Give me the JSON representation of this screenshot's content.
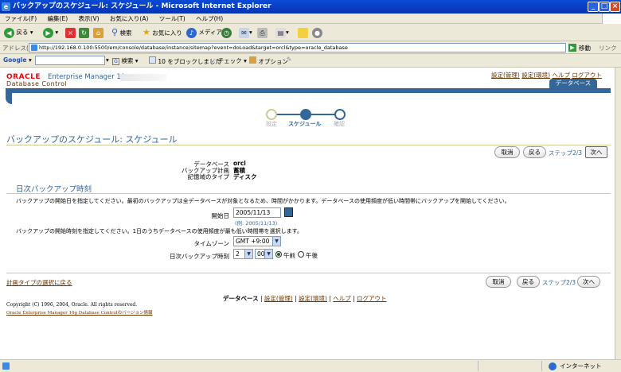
{
  "window": {
    "title": "バックアップのスケジュール: スケジュール - Microsoft Internet Explorer"
  },
  "menu": [
    "ファイル(F)",
    "編集(E)",
    "表示(V)",
    "お気に入り(A)",
    "ツール(T)",
    "ヘルプ(H)"
  ],
  "toolbar": {
    "back": "戻る",
    "search": "検索",
    "favorites": "お気に入り",
    "media": "メディア"
  },
  "address": {
    "label": "アドレス(D)",
    "url": "http://192.168.0.100:5500/em/console/database/instance/sitemap?event=doLoad&target=orcl&type=oracle_database",
    "go": "移動",
    "links": "リンク"
  },
  "google": {
    "logo": "Google",
    "search": "検索",
    "blocked": "10 をブロックしました",
    "check": "チェック",
    "options": "オプション"
  },
  "header": {
    "oracle": "ORACLE",
    "em": "Enterprise Manager 10g",
    "dbcontrol": "Database Control",
    "links": [
      "設定(管理)",
      "設定(環境)",
      "ヘルプ",
      "ログアウト"
    ],
    "tab": "データベース"
  },
  "train": {
    "steps": [
      "設定",
      "スケジュール",
      "確認"
    ],
    "current": 1
  },
  "page": {
    "title": "バックアップのスケジュール: スケジュール"
  },
  "buttons": {
    "cancel": "取消",
    "back": "戻る",
    "next": "次へ",
    "step": "ステップ2/3"
  },
  "info": {
    "labels": [
      "データベース",
      "バックアップ計画",
      "記憶域のタイプ"
    ],
    "values": [
      "orcl",
      "蓄積",
      "ディスク"
    ]
  },
  "section": {
    "title": "日次バックアップ時刻"
  },
  "form": {
    "desc1": "バックアップの開始日を指定してください。最初のバックアップは全データベースが対象となるため、時間がかかります。データベースの使用頻度が低い時間帯にバックアップを開始してください。",
    "start_label": "開始日",
    "start_value": "2005/11/13",
    "start_example": "(例: 2005/11/13)",
    "desc2": "バックアップの開始時刻を指定してください。1日のうちデータベースの使用頻度が最も低い時間帯を選択します。",
    "tz_label": "タイムゾーン",
    "tz_value": "GMT +9:00",
    "time_label": "日次バックアップ時刻",
    "hour": "2",
    "minute": "00",
    "am": "午前",
    "pm": "午後"
  },
  "return_link": "計画タイプの選択に戻る",
  "footer": {
    "links": [
      "データベース",
      "設定(管理)",
      "設定(環境)",
      "ヘルプ",
      "ログアウト"
    ],
    "copyright": "Copyright (C) 1996, 2004, Oracle. All rights reserved.",
    "version": "Oracle Enterprise Manager 10g Database Controlのバージョン情報"
  },
  "status": {
    "zone": "インターネット"
  }
}
